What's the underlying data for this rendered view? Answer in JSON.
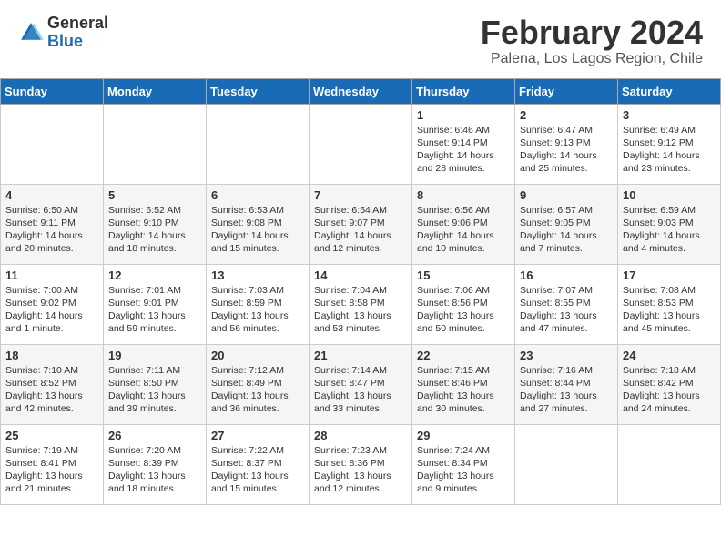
{
  "logo": {
    "general": "General",
    "blue": "Blue"
  },
  "title": "February 2024",
  "subtitle": "Palena, Los Lagos Region, Chile",
  "days_header": [
    "Sunday",
    "Monday",
    "Tuesday",
    "Wednesday",
    "Thursday",
    "Friday",
    "Saturday"
  ],
  "weeks": [
    [
      {
        "day": "",
        "sunrise": "",
        "sunset": "",
        "daylight": ""
      },
      {
        "day": "",
        "sunrise": "",
        "sunset": "",
        "daylight": ""
      },
      {
        "day": "",
        "sunrise": "",
        "sunset": "",
        "daylight": ""
      },
      {
        "day": "",
        "sunrise": "",
        "sunset": "",
        "daylight": ""
      },
      {
        "day": "1",
        "sunrise": "Sunrise: 6:46 AM",
        "sunset": "Sunset: 9:14 PM",
        "daylight": "Daylight: 14 hours and 28 minutes."
      },
      {
        "day": "2",
        "sunrise": "Sunrise: 6:47 AM",
        "sunset": "Sunset: 9:13 PM",
        "daylight": "Daylight: 14 hours and 25 minutes."
      },
      {
        "day": "3",
        "sunrise": "Sunrise: 6:49 AM",
        "sunset": "Sunset: 9:12 PM",
        "daylight": "Daylight: 14 hours and 23 minutes."
      }
    ],
    [
      {
        "day": "4",
        "sunrise": "Sunrise: 6:50 AM",
        "sunset": "Sunset: 9:11 PM",
        "daylight": "Daylight: 14 hours and 20 minutes."
      },
      {
        "day": "5",
        "sunrise": "Sunrise: 6:52 AM",
        "sunset": "Sunset: 9:10 PM",
        "daylight": "Daylight: 14 hours and 18 minutes."
      },
      {
        "day": "6",
        "sunrise": "Sunrise: 6:53 AM",
        "sunset": "Sunset: 9:08 PM",
        "daylight": "Daylight: 14 hours and 15 minutes."
      },
      {
        "day": "7",
        "sunrise": "Sunrise: 6:54 AM",
        "sunset": "Sunset: 9:07 PM",
        "daylight": "Daylight: 14 hours and 12 minutes."
      },
      {
        "day": "8",
        "sunrise": "Sunrise: 6:56 AM",
        "sunset": "Sunset: 9:06 PM",
        "daylight": "Daylight: 14 hours and 10 minutes."
      },
      {
        "day": "9",
        "sunrise": "Sunrise: 6:57 AM",
        "sunset": "Sunset: 9:05 PM",
        "daylight": "Daylight: 14 hours and 7 minutes."
      },
      {
        "day": "10",
        "sunrise": "Sunrise: 6:59 AM",
        "sunset": "Sunset: 9:03 PM",
        "daylight": "Daylight: 14 hours and 4 minutes."
      }
    ],
    [
      {
        "day": "11",
        "sunrise": "Sunrise: 7:00 AM",
        "sunset": "Sunset: 9:02 PM",
        "daylight": "Daylight: 14 hours and 1 minute."
      },
      {
        "day": "12",
        "sunrise": "Sunrise: 7:01 AM",
        "sunset": "Sunset: 9:01 PM",
        "daylight": "Daylight: 13 hours and 59 minutes."
      },
      {
        "day": "13",
        "sunrise": "Sunrise: 7:03 AM",
        "sunset": "Sunset: 8:59 PM",
        "daylight": "Daylight: 13 hours and 56 minutes."
      },
      {
        "day": "14",
        "sunrise": "Sunrise: 7:04 AM",
        "sunset": "Sunset: 8:58 PM",
        "daylight": "Daylight: 13 hours and 53 minutes."
      },
      {
        "day": "15",
        "sunrise": "Sunrise: 7:06 AM",
        "sunset": "Sunset: 8:56 PM",
        "daylight": "Daylight: 13 hours and 50 minutes."
      },
      {
        "day": "16",
        "sunrise": "Sunrise: 7:07 AM",
        "sunset": "Sunset: 8:55 PM",
        "daylight": "Daylight: 13 hours and 47 minutes."
      },
      {
        "day": "17",
        "sunrise": "Sunrise: 7:08 AM",
        "sunset": "Sunset: 8:53 PM",
        "daylight": "Daylight: 13 hours and 45 minutes."
      }
    ],
    [
      {
        "day": "18",
        "sunrise": "Sunrise: 7:10 AM",
        "sunset": "Sunset: 8:52 PM",
        "daylight": "Daylight: 13 hours and 42 minutes."
      },
      {
        "day": "19",
        "sunrise": "Sunrise: 7:11 AM",
        "sunset": "Sunset: 8:50 PM",
        "daylight": "Daylight: 13 hours and 39 minutes."
      },
      {
        "day": "20",
        "sunrise": "Sunrise: 7:12 AM",
        "sunset": "Sunset: 8:49 PM",
        "daylight": "Daylight: 13 hours and 36 minutes."
      },
      {
        "day": "21",
        "sunrise": "Sunrise: 7:14 AM",
        "sunset": "Sunset: 8:47 PM",
        "daylight": "Daylight: 13 hours and 33 minutes."
      },
      {
        "day": "22",
        "sunrise": "Sunrise: 7:15 AM",
        "sunset": "Sunset: 8:46 PM",
        "daylight": "Daylight: 13 hours and 30 minutes."
      },
      {
        "day": "23",
        "sunrise": "Sunrise: 7:16 AM",
        "sunset": "Sunset: 8:44 PM",
        "daylight": "Daylight: 13 hours and 27 minutes."
      },
      {
        "day": "24",
        "sunrise": "Sunrise: 7:18 AM",
        "sunset": "Sunset: 8:42 PM",
        "daylight": "Daylight: 13 hours and 24 minutes."
      }
    ],
    [
      {
        "day": "25",
        "sunrise": "Sunrise: 7:19 AM",
        "sunset": "Sunset: 8:41 PM",
        "daylight": "Daylight: 13 hours and 21 minutes."
      },
      {
        "day": "26",
        "sunrise": "Sunrise: 7:20 AM",
        "sunset": "Sunset: 8:39 PM",
        "daylight": "Daylight: 13 hours and 18 minutes."
      },
      {
        "day": "27",
        "sunrise": "Sunrise: 7:22 AM",
        "sunset": "Sunset: 8:37 PM",
        "daylight": "Daylight: 13 hours and 15 minutes."
      },
      {
        "day": "28",
        "sunrise": "Sunrise: 7:23 AM",
        "sunset": "Sunset: 8:36 PM",
        "daylight": "Daylight: 13 hours and 12 minutes."
      },
      {
        "day": "29",
        "sunrise": "Sunrise: 7:24 AM",
        "sunset": "Sunset: 8:34 PM",
        "daylight": "Daylight: 13 hours and 9 minutes."
      },
      {
        "day": "",
        "sunrise": "",
        "sunset": "",
        "daylight": ""
      },
      {
        "day": "",
        "sunrise": "",
        "sunset": "",
        "daylight": ""
      }
    ]
  ]
}
